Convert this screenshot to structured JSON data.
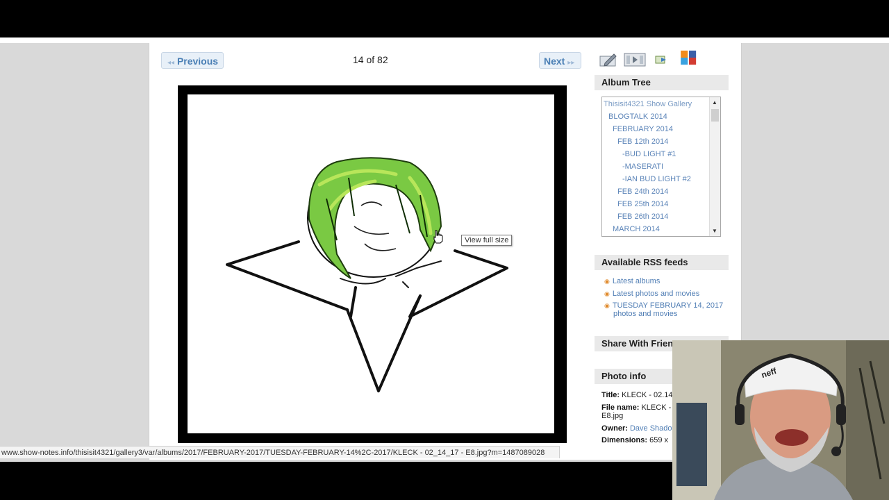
{
  "nav": {
    "prev_label": "Previous",
    "next_label": "Next",
    "counter": "14 of 82"
  },
  "photo": {
    "tooltip": "View full size"
  },
  "toolbar": {
    "icons": [
      "edit-icon",
      "slideshow-icon",
      "send-icon",
      "share-services-icon"
    ]
  },
  "album_tree": {
    "title": "Album Tree",
    "items": [
      "Thisisit4321 Show Gallery",
      "BLOGTALK 2014",
      "FEBRUARY 2014",
      "FEB 12th 2014",
      "-BUD LIGHT #1",
      "-MASERATI",
      "-IAN BUD LIGHT #2",
      "FEB 24th 2014",
      "FEB 25th 2014",
      "FEB 26th 2014",
      "MARCH 2014"
    ]
  },
  "rss": {
    "title": "Available RSS feeds",
    "items": [
      "Latest albums",
      "Latest photos and movies",
      "TUESDAY FEBRUARY 14, 2017",
      "photos and movies"
    ]
  },
  "share": {
    "title": "Share With Frien"
  },
  "photo_info": {
    "title": "Photo info",
    "title_label": "Title:",
    "title_value": "KLECK - 02.14",
    "filename_label": "File name:",
    "filename_value": "KLECK - C",
    "filename_cont": "E8.jpg",
    "owner_label": "Owner:",
    "owner_value": "Dave Shadow",
    "dimensions_label": "Dimensions:",
    "dimensions_value": "659 x"
  },
  "status_bar": {
    "url": "www.show-notes.info/thisisit4321/gallery3/var/albums/2017/FEBRUARY-2017/TUESDAY-FEBRUARY-14%2C-2017/KLECK - 02_14_17 - E8.jpg?m=1487089028"
  },
  "webcam": {
    "cap_text": "neff"
  }
}
